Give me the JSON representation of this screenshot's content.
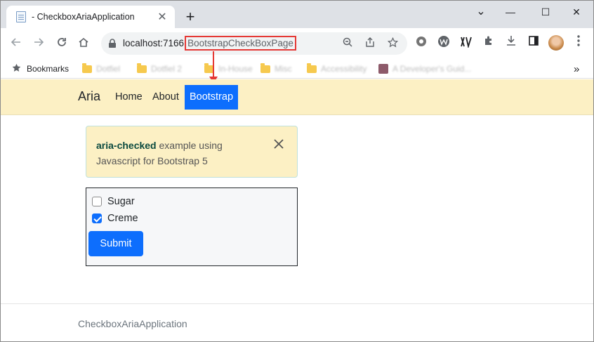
{
  "browser": {
    "tab_title": "- CheckboxAriaApplication",
    "tab_close": "✕",
    "new_tab": "+",
    "window_controls": {
      "minimize": "—",
      "maximize": "☐",
      "close": "✕",
      "tab_search": "⌄"
    },
    "url_host": "localhost:7166",
    "url_path": "BootstrapCheckBoxPage",
    "icons": [
      "back-arrow-icon",
      "forward-arrow-icon",
      "reload-icon",
      "home-icon",
      "lock-icon",
      "zoom-icon",
      "share-icon",
      "star-icon",
      "settings-extension-icon",
      "w-extension-icon",
      "translate-extension-icon",
      "puzzle-icon",
      "download-icon",
      "sidebar-icon",
      "profile-avatar",
      "menu-kebab-icon"
    ],
    "bookmarks_label": "Bookmarks",
    "bookmarks": [
      "Dotfiel",
      "Dotfiel 2",
      "In-House",
      "Misc",
      "Accessibility",
      "A Developer's Guid..."
    ],
    "bookmarks_overflow": "»"
  },
  "navbar": {
    "brand": "Aria",
    "links": [
      "Home",
      "About"
    ],
    "active_link": "Bootstrap"
  },
  "alert": {
    "strong": "aria-checked",
    "text": " example using Javascript for Bootstrap 5",
    "close": "✕"
  },
  "form": {
    "checkboxes": [
      {
        "label": "Sugar",
        "checked": false
      },
      {
        "label": "Creme",
        "checked": true
      }
    ],
    "submit_label": "Submit"
  },
  "footer": {
    "text": "CheckboxAriaApplication"
  },
  "colors": {
    "accent": "#0d6efd",
    "navbar_bg": "#fcf0c4",
    "annotation_red": "#e53935"
  }
}
